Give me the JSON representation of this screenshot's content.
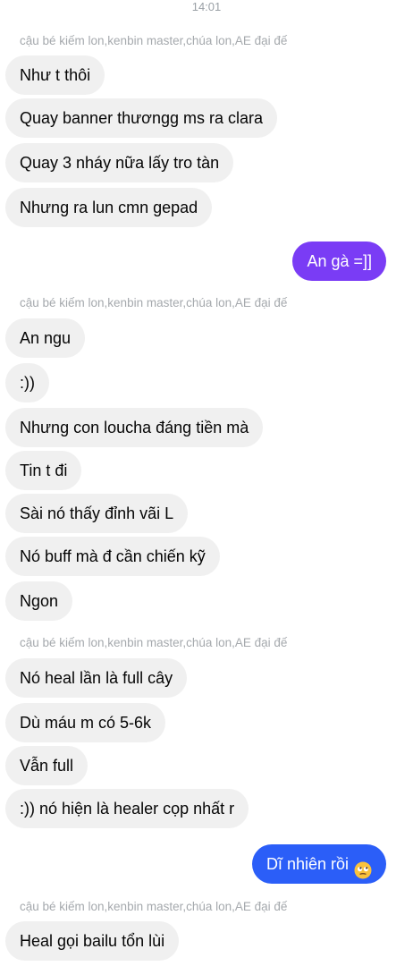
{
  "chat": {
    "timestamp": "14:01",
    "groups": [
      {
        "sender": "cậu bé kiếm lon,kenbin master,chúa lon,AE đại đế",
        "messages": [
          "Như t thôi",
          "Quay banner thươngg ms ra clara",
          "Quay 3 nháy nữa lấy tro tàn",
          "Nhưng ra lun cmn gepad"
        ]
      },
      {
        "outgoing": [
          "An gà =]]"
        ]
      },
      {
        "sender": "cậu bé kiếm lon,kenbin master,chúa lon,AE đại đế",
        "messages": [
          "An ngu",
          ":))",
          "Nhưng con loucha đáng tiền mà",
          "Tin t đi",
          "Sài nó thấy đỉnh vãi L",
          "Nó buff mà đ cần chiến kỹ",
          "Ngon"
        ]
      },
      {
        "sender": "cậu bé kiếm lon,kenbin master,chúa lon,AE đại đế",
        "messages": [
          "Nó heal lần là full cây",
          "Dù máu m có 5-6k",
          "Vẫn full",
          ":)) nó hiện là healer cọp nhất r"
        ]
      },
      {
        "outgoing": [
          "Dĩ nhiên rồi"
        ],
        "outgoing_emoji": "rolling-eyes-emoji"
      },
      {
        "sender": "cậu bé kiếm lon,kenbin master,chúa lon,AE đại đế",
        "messages": [
          "Heal gọi bailu tổn lùi"
        ]
      }
    ]
  },
  "colors": {
    "incoming_bubble": "#f0f0f0",
    "outgoing_violet": "#7a3cf5",
    "outgoing_blue": "#2b5ef8",
    "sender_text": "#a5a9ad"
  }
}
